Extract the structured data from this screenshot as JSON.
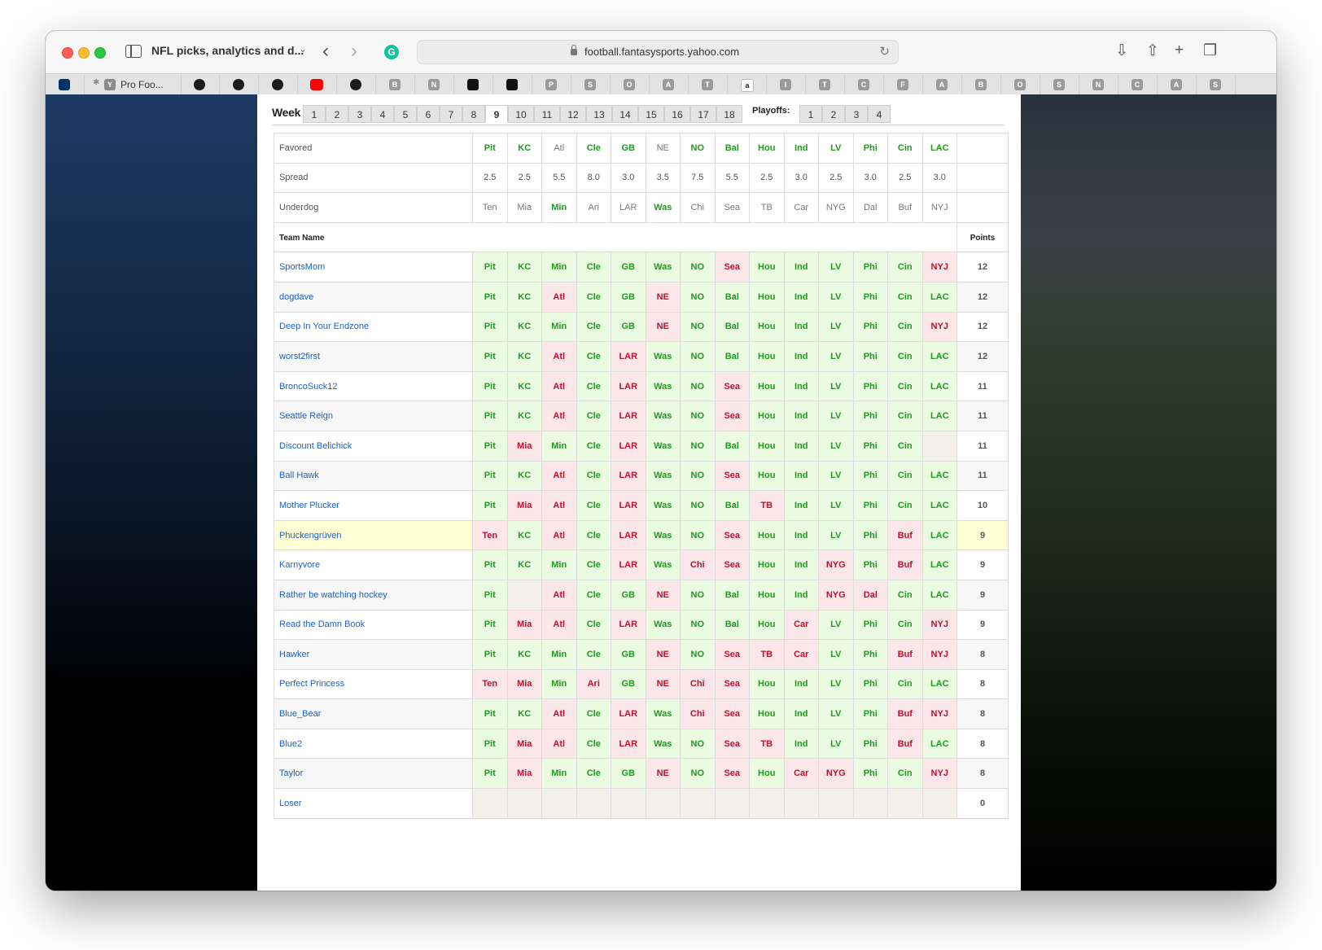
{
  "browser": {
    "window_title": "NFL picks, analytics and d...",
    "url": "football.fantasysports.yahoo.com",
    "pinned_tab_label": "Pro Foo...",
    "tab_letters": [
      "B",
      "N",
      "P",
      "S",
      "O",
      "A",
      "T",
      "I",
      "T",
      "C",
      "F",
      "A",
      "B",
      "O",
      "S",
      "N",
      "C",
      "A",
      "S"
    ]
  },
  "weeks": {
    "label": "Week",
    "items": [
      "1",
      "2",
      "3",
      "4",
      "5",
      "6",
      "7",
      "8",
      "9",
      "10",
      "11",
      "12",
      "13",
      "14",
      "15",
      "16",
      "17",
      "18"
    ],
    "active": "9",
    "playoffs_label": "Playoffs:",
    "playoffs": [
      "1",
      "2",
      "3",
      "4"
    ]
  },
  "labels": {
    "favored": "Favored",
    "spread": "Spread",
    "underdog": "Underdog",
    "team_name": "Team Name",
    "points": "Points"
  },
  "games": [
    {
      "favored": "Pit",
      "spread": "2.5",
      "underdog": "Ten",
      "winner": "fav"
    },
    {
      "favored": "KC",
      "spread": "2.5",
      "underdog": "Mia",
      "winner": "fav"
    },
    {
      "favored": "Atl",
      "spread": "5.5",
      "underdog": "Min",
      "winner": "dog"
    },
    {
      "favored": "Cle",
      "spread": "8.0",
      "underdog": "Ari",
      "winner": "fav"
    },
    {
      "favored": "GB",
      "spread": "3.0",
      "underdog": "LAR",
      "winner": "fav"
    },
    {
      "favored": "NE",
      "spread": "3.5",
      "underdog": "Was",
      "winner": "dog"
    },
    {
      "favored": "NO",
      "spread": "7.5",
      "underdog": "Chi",
      "winner": "fav"
    },
    {
      "favored": "Bal",
      "spread": "5.5",
      "underdog": "Sea",
      "winner": "fav"
    },
    {
      "favored": "Hou",
      "spread": "2.5",
      "underdog": "TB",
      "winner": "fav"
    },
    {
      "favored": "Ind",
      "spread": "3.0",
      "underdog": "Car",
      "winner": "fav"
    },
    {
      "favored": "LV",
      "spread": "2.5",
      "underdog": "NYG",
      "winner": "fav"
    },
    {
      "favored": "Phi",
      "spread": "3.0",
      "underdog": "Dal",
      "winner": "fav"
    },
    {
      "favored": "Cin",
      "spread": "2.5",
      "underdog": "Buf",
      "winner": "fav"
    },
    {
      "favored": "LAC",
      "spread": "3.0",
      "underdog": "NYJ",
      "winner": "fav"
    }
  ],
  "teams": [
    {
      "name": "SportsMom",
      "points": "12",
      "picks": [
        [
          "Pit",
          "w"
        ],
        [
          "KC",
          "w"
        ],
        [
          "Min",
          "w"
        ],
        [
          "Cle",
          "w"
        ],
        [
          "GB",
          "w"
        ],
        [
          "Was",
          "w"
        ],
        [
          "NO",
          "w"
        ],
        [
          "Sea",
          "l"
        ],
        [
          "Hou",
          "w"
        ],
        [
          "Ind",
          "w"
        ],
        [
          "LV",
          "w"
        ],
        [
          "Phi",
          "w"
        ],
        [
          "Cin",
          "w"
        ],
        [
          "NYJ",
          "l"
        ]
      ]
    },
    {
      "name": "dogdave",
      "points": "12",
      "picks": [
        [
          "Pit",
          "w"
        ],
        [
          "KC",
          "w"
        ],
        [
          "Atl",
          "l"
        ],
        [
          "Cle",
          "w"
        ],
        [
          "GB",
          "w"
        ],
        [
          "NE",
          "l"
        ],
        [
          "NO",
          "w"
        ],
        [
          "Bal",
          "w"
        ],
        [
          "Hou",
          "w"
        ],
        [
          "Ind",
          "w"
        ],
        [
          "LV",
          "w"
        ],
        [
          "Phi",
          "w"
        ],
        [
          "Cin",
          "w"
        ],
        [
          "LAC",
          "w"
        ]
      ]
    },
    {
      "name": "Deep In Your Endzone",
      "points": "12",
      "picks": [
        [
          "Pit",
          "w"
        ],
        [
          "KC",
          "w"
        ],
        [
          "Min",
          "w"
        ],
        [
          "Cle",
          "w"
        ],
        [
          "GB",
          "w"
        ],
        [
          "NE",
          "l"
        ],
        [
          "NO",
          "w"
        ],
        [
          "Bal",
          "w"
        ],
        [
          "Hou",
          "w"
        ],
        [
          "Ind",
          "w"
        ],
        [
          "LV",
          "w"
        ],
        [
          "Phi",
          "w"
        ],
        [
          "Cin",
          "w"
        ],
        [
          "NYJ",
          "l"
        ]
      ]
    },
    {
      "name": "worst2first",
      "points": "12",
      "picks": [
        [
          "Pit",
          "w"
        ],
        [
          "KC",
          "w"
        ],
        [
          "Atl",
          "l"
        ],
        [
          "Cle",
          "w"
        ],
        [
          "LAR",
          "l"
        ],
        [
          "Was",
          "w"
        ],
        [
          "NO",
          "w"
        ],
        [
          "Bal",
          "w"
        ],
        [
          "Hou",
          "w"
        ],
        [
          "Ind",
          "w"
        ],
        [
          "LV",
          "w"
        ],
        [
          "Phi",
          "w"
        ],
        [
          "Cin",
          "w"
        ],
        [
          "LAC",
          "w"
        ]
      ]
    },
    {
      "name": "BroncoSuck12",
      "points": "11",
      "picks": [
        [
          "Pit",
          "w"
        ],
        [
          "KC",
          "w"
        ],
        [
          "Atl",
          "l"
        ],
        [
          "Cle",
          "w"
        ],
        [
          "LAR",
          "l"
        ],
        [
          "Was",
          "w"
        ],
        [
          "NO",
          "w"
        ],
        [
          "Sea",
          "l"
        ],
        [
          "Hou",
          "w"
        ],
        [
          "Ind",
          "w"
        ],
        [
          "LV",
          "w"
        ],
        [
          "Phi",
          "w"
        ],
        [
          "Cin",
          "w"
        ],
        [
          "LAC",
          "w"
        ]
      ]
    },
    {
      "name": "Seattle Reign",
      "points": "11",
      "picks": [
        [
          "Pit",
          "w"
        ],
        [
          "KC",
          "w"
        ],
        [
          "Atl",
          "l"
        ],
        [
          "Cle",
          "w"
        ],
        [
          "LAR",
          "l"
        ],
        [
          "Was",
          "w"
        ],
        [
          "NO",
          "w"
        ],
        [
          "Sea",
          "l"
        ],
        [
          "Hou",
          "w"
        ],
        [
          "Ind",
          "w"
        ],
        [
          "LV",
          "w"
        ],
        [
          "Phi",
          "w"
        ],
        [
          "Cin",
          "w"
        ],
        [
          "LAC",
          "w"
        ]
      ]
    },
    {
      "name": "Discount Belichick",
      "points": "11",
      "picks": [
        [
          "Pit",
          "w"
        ],
        [
          "Mia",
          "l"
        ],
        [
          "Min",
          "w"
        ],
        [
          "Cle",
          "w"
        ],
        [
          "LAR",
          "l"
        ],
        [
          "Was",
          "w"
        ],
        [
          "NO",
          "w"
        ],
        [
          "Bal",
          "w"
        ],
        [
          "Hou",
          "w"
        ],
        [
          "Ind",
          "w"
        ],
        [
          "LV",
          "w"
        ],
        [
          "Phi",
          "w"
        ],
        [
          "Cin",
          "w"
        ],
        [
          "",
          "e"
        ]
      ]
    },
    {
      "name": "Ball Hawk",
      "points": "11",
      "picks": [
        [
          "Pit",
          "w"
        ],
        [
          "KC",
          "w"
        ],
        [
          "Atl",
          "l"
        ],
        [
          "Cle",
          "w"
        ],
        [
          "LAR",
          "l"
        ],
        [
          "Was",
          "w"
        ],
        [
          "NO",
          "w"
        ],
        [
          "Sea",
          "l"
        ],
        [
          "Hou",
          "w"
        ],
        [
          "Ind",
          "w"
        ],
        [
          "LV",
          "w"
        ],
        [
          "Phi",
          "w"
        ],
        [
          "Cin",
          "w"
        ],
        [
          "LAC",
          "w"
        ]
      ]
    },
    {
      "name": "Mother Plucker",
      "points": "10",
      "picks": [
        [
          "Pit",
          "w"
        ],
        [
          "Mia",
          "l"
        ],
        [
          "Atl",
          "l"
        ],
        [
          "Cle",
          "w"
        ],
        [
          "LAR",
          "l"
        ],
        [
          "Was",
          "w"
        ],
        [
          "NO",
          "w"
        ],
        [
          "Bal",
          "w"
        ],
        [
          "TB",
          "l"
        ],
        [
          "Ind",
          "w"
        ],
        [
          "LV",
          "w"
        ],
        [
          "Phi",
          "w"
        ],
        [
          "Cin",
          "w"
        ],
        [
          "LAC",
          "w"
        ]
      ]
    },
    {
      "name": "Phuckengrüven",
      "points": "9",
      "highlight": true,
      "picks": [
        [
          "Ten",
          "l"
        ],
        [
          "KC",
          "w"
        ],
        [
          "Atl",
          "l"
        ],
        [
          "Cle",
          "w"
        ],
        [
          "LAR",
          "l"
        ],
        [
          "Was",
          "w"
        ],
        [
          "NO",
          "w"
        ],
        [
          "Sea",
          "l"
        ],
        [
          "Hou",
          "w"
        ],
        [
          "Ind",
          "w"
        ],
        [
          "LV",
          "w"
        ],
        [
          "Phi",
          "w"
        ],
        [
          "Buf",
          "l"
        ],
        [
          "LAC",
          "w"
        ]
      ]
    },
    {
      "name": "Karnyvore",
      "points": "9",
      "picks": [
        [
          "Pit",
          "w"
        ],
        [
          "KC",
          "w"
        ],
        [
          "Min",
          "w"
        ],
        [
          "Cle",
          "w"
        ],
        [
          "LAR",
          "l"
        ],
        [
          "Was",
          "w"
        ],
        [
          "Chi",
          "l"
        ],
        [
          "Sea",
          "l"
        ],
        [
          "Hou",
          "w"
        ],
        [
          "Ind",
          "w"
        ],
        [
          "NYG",
          "l"
        ],
        [
          "Phi",
          "w"
        ],
        [
          "Buf",
          "l"
        ],
        [
          "LAC",
          "w"
        ]
      ]
    },
    {
      "name": "Rather be watching hockey",
      "points": "9",
      "picks": [
        [
          "Pit",
          "w"
        ],
        [
          "",
          "e"
        ],
        [
          "Atl",
          "l"
        ],
        [
          "Cle",
          "w"
        ],
        [
          "GB",
          "w"
        ],
        [
          "NE",
          "l"
        ],
        [
          "NO",
          "w"
        ],
        [
          "Bal",
          "w"
        ],
        [
          "Hou",
          "w"
        ],
        [
          "Ind",
          "w"
        ],
        [
          "NYG",
          "l"
        ],
        [
          "Dal",
          "l"
        ],
        [
          "Cin",
          "w"
        ],
        [
          "LAC",
          "w"
        ]
      ]
    },
    {
      "name": "Read the Damn Book",
      "points": "9",
      "picks": [
        [
          "Pit",
          "w"
        ],
        [
          "Mia",
          "l"
        ],
        [
          "Atl",
          "l"
        ],
        [
          "Cle",
          "w"
        ],
        [
          "LAR",
          "l"
        ],
        [
          "Was",
          "w"
        ],
        [
          "NO",
          "w"
        ],
        [
          "Bal",
          "w"
        ],
        [
          "Hou",
          "w"
        ],
        [
          "Car",
          "l"
        ],
        [
          "LV",
          "w"
        ],
        [
          "Phi",
          "w"
        ],
        [
          "Cin",
          "w"
        ],
        [
          "NYJ",
          "l"
        ]
      ]
    },
    {
      "name": "Hawker",
      "points": "8",
      "picks": [
        [
          "Pit",
          "w"
        ],
        [
          "KC",
          "w"
        ],
        [
          "Min",
          "w"
        ],
        [
          "Cle",
          "w"
        ],
        [
          "GB",
          "w"
        ],
        [
          "NE",
          "l"
        ],
        [
          "NO",
          "w"
        ],
        [
          "Sea",
          "l"
        ],
        [
          "TB",
          "l"
        ],
        [
          "Car",
          "l"
        ],
        [
          "LV",
          "w"
        ],
        [
          "Phi",
          "w"
        ],
        [
          "Buf",
          "l"
        ],
        [
          "NYJ",
          "l"
        ]
      ]
    },
    {
      "name": "Perfect Princess",
      "points": "8",
      "picks": [
        [
          "Ten",
          "l"
        ],
        [
          "Mia",
          "l"
        ],
        [
          "Min",
          "w"
        ],
        [
          "Ari",
          "l"
        ],
        [
          "GB",
          "w"
        ],
        [
          "NE",
          "l"
        ],
        [
          "Chi",
          "l"
        ],
        [
          "Sea",
          "l"
        ],
        [
          "Hou",
          "w"
        ],
        [
          "Ind",
          "w"
        ],
        [
          "LV",
          "w"
        ],
        [
          "Phi",
          "w"
        ],
        [
          "Cin",
          "w"
        ],
        [
          "LAC",
          "w"
        ]
      ]
    },
    {
      "name": "Blue_Bear",
      "points": "8",
      "picks": [
        [
          "Pit",
          "w"
        ],
        [
          "KC",
          "w"
        ],
        [
          "Atl",
          "l"
        ],
        [
          "Cle",
          "w"
        ],
        [
          "LAR",
          "l"
        ],
        [
          "Was",
          "w"
        ],
        [
          "Chi",
          "l"
        ],
        [
          "Sea",
          "l"
        ],
        [
          "Hou",
          "w"
        ],
        [
          "Ind",
          "w"
        ],
        [
          "LV",
          "w"
        ],
        [
          "Phi",
          "w"
        ],
        [
          "Buf",
          "l"
        ],
        [
          "NYJ",
          "l"
        ]
      ]
    },
    {
      "name": "Blue2",
      "points": "8",
      "picks": [
        [
          "Pit",
          "w"
        ],
        [
          "Mia",
          "l"
        ],
        [
          "Atl",
          "l"
        ],
        [
          "Cle",
          "w"
        ],
        [
          "LAR",
          "l"
        ],
        [
          "Was",
          "w"
        ],
        [
          "NO",
          "w"
        ],
        [
          "Sea",
          "l"
        ],
        [
          "TB",
          "l"
        ],
        [
          "Ind",
          "w"
        ],
        [
          "LV",
          "w"
        ],
        [
          "Phi",
          "w"
        ],
        [
          "Buf",
          "l"
        ],
        [
          "LAC",
          "w"
        ]
      ]
    },
    {
      "name": "Taylor",
      "points": "8",
      "picks": [
        [
          "Pit",
          "w"
        ],
        [
          "Mia",
          "l"
        ],
        [
          "Min",
          "w"
        ],
        [
          "Cle",
          "w"
        ],
        [
          "GB",
          "w"
        ],
        [
          "NE",
          "l"
        ],
        [
          "NO",
          "w"
        ],
        [
          "Sea",
          "l"
        ],
        [
          "Hou",
          "w"
        ],
        [
          "Car",
          "l"
        ],
        [
          "NYG",
          "l"
        ],
        [
          "Phi",
          "w"
        ],
        [
          "Cin",
          "w"
        ],
        [
          "NYJ",
          "l"
        ]
      ]
    },
    {
      "name": "Loser",
      "points": "0",
      "picks": [
        [
          "",
          "e"
        ],
        [
          "",
          "e"
        ],
        [
          "",
          "e"
        ],
        [
          "",
          "e"
        ],
        [
          "",
          "e"
        ],
        [
          "",
          "e"
        ],
        [
          "",
          "e"
        ],
        [
          "",
          "e"
        ],
        [
          "",
          "e"
        ],
        [
          "",
          "e"
        ],
        [
          "",
          "e"
        ],
        [
          "",
          "e"
        ],
        [
          "",
          "e"
        ],
        [
          "",
          "e"
        ]
      ]
    }
  ]
}
